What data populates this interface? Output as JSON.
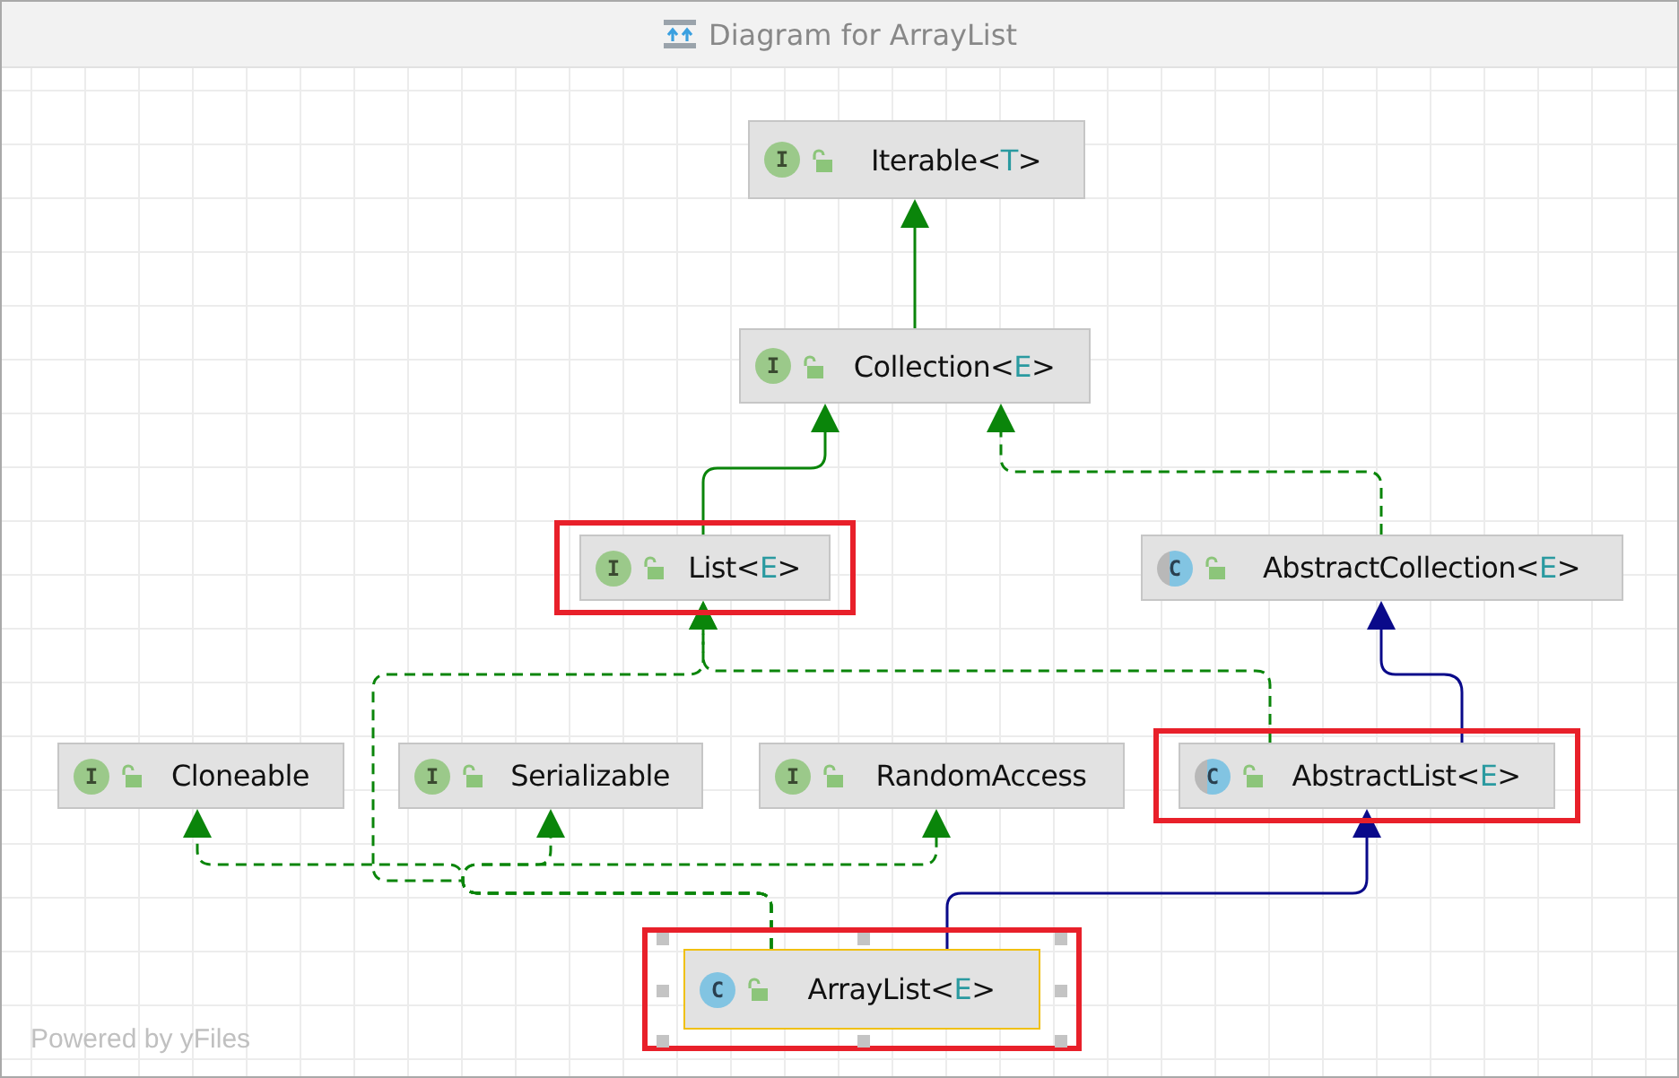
{
  "window": {
    "title": "Diagram for ArrayList"
  },
  "nodes": [
    {
      "kind": "interface",
      "badge": "I",
      "label_parts": [
        "Iterable<",
        "T",
        ">"
      ],
      "highlighted": false,
      "selected": false
    },
    {
      "kind": "interface",
      "badge": "I",
      "label_parts": [
        "Collection<",
        "E",
        ">"
      ],
      "highlighted": false,
      "selected": false
    },
    {
      "kind": "interface",
      "badge": "I",
      "label_parts": [
        "List<",
        "E",
        ">"
      ],
      "highlighted": true,
      "selected": false
    },
    {
      "kind": "abstract_class",
      "badge": "C",
      "label_parts": [
        "AbstractCollection<",
        "E",
        ">"
      ],
      "highlighted": false,
      "selected": false
    },
    {
      "kind": "interface",
      "badge": "I",
      "label_parts": [
        "Cloneable"
      ],
      "highlighted": false,
      "selected": false
    },
    {
      "kind": "interface",
      "badge": "I",
      "label_parts": [
        "Serializable"
      ],
      "highlighted": false,
      "selected": false
    },
    {
      "kind": "interface",
      "badge": "I",
      "label_parts": [
        "RandomAccess"
      ],
      "highlighted": false,
      "selected": false
    },
    {
      "kind": "abstract_class",
      "badge": "C",
      "label_parts": [
        "AbstractList<",
        "E",
        ">"
      ],
      "highlighted": true,
      "selected": false
    },
    {
      "kind": "class",
      "badge": "C",
      "label_parts": [
        "ArrayList<",
        "E",
        ">"
      ],
      "highlighted": true,
      "selected": true
    }
  ],
  "edges": [
    {
      "kind": "interface_extends"
    },
    {
      "kind": "interface_extends"
    },
    {
      "kind": "implements"
    },
    {
      "kind": "class_extends"
    },
    {
      "kind": "implements"
    },
    {
      "kind": "class_extends"
    },
    {
      "kind": "implements"
    },
    {
      "kind": "implements"
    },
    {
      "kind": "implements"
    },
    {
      "kind": "implements"
    }
  ],
  "watermark": "Powered by yFiles"
}
